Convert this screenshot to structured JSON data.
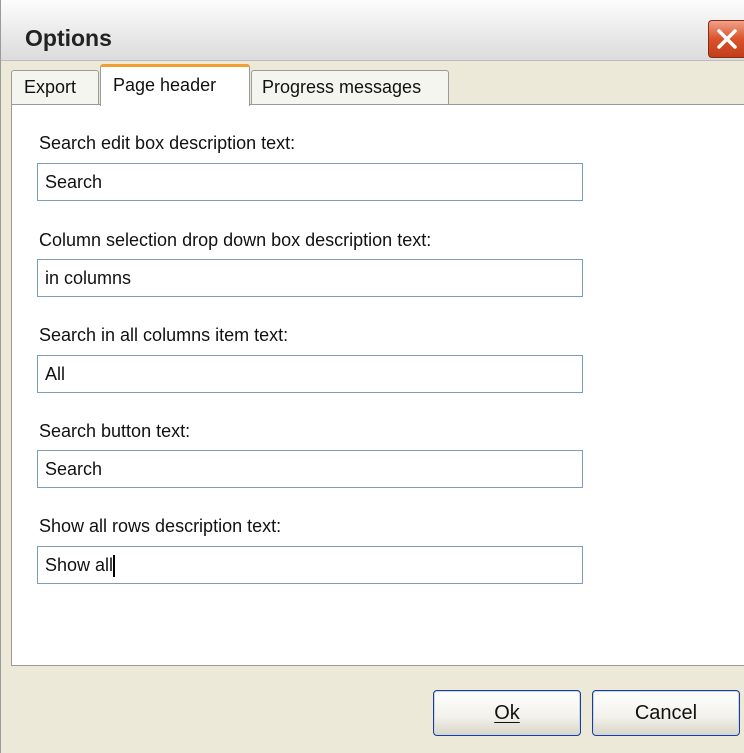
{
  "window": {
    "title": "Options"
  },
  "tabs": [
    {
      "label": "Export",
      "active": false
    },
    {
      "label": "Page header",
      "active": true
    },
    {
      "label": "Progress messages",
      "active": false
    }
  ],
  "fields": [
    {
      "label": "Search edit box description text:",
      "value": "Search"
    },
    {
      "label": "Column selection drop down box description text:",
      "value": "in columns"
    },
    {
      "label": "Search in all columns item text:",
      "value": "All"
    },
    {
      "label": "Search button text:",
      "value": "Search"
    },
    {
      "label": "Show all rows description text:",
      "value": "Show all"
    }
  ],
  "buttons": {
    "ok_label": "Ok",
    "cancel_label": "Cancel"
  },
  "icons": {
    "close": "close-icon"
  },
  "colors": {
    "active_tab_accent": "#f0a030",
    "close_button": "#d9532c"
  }
}
